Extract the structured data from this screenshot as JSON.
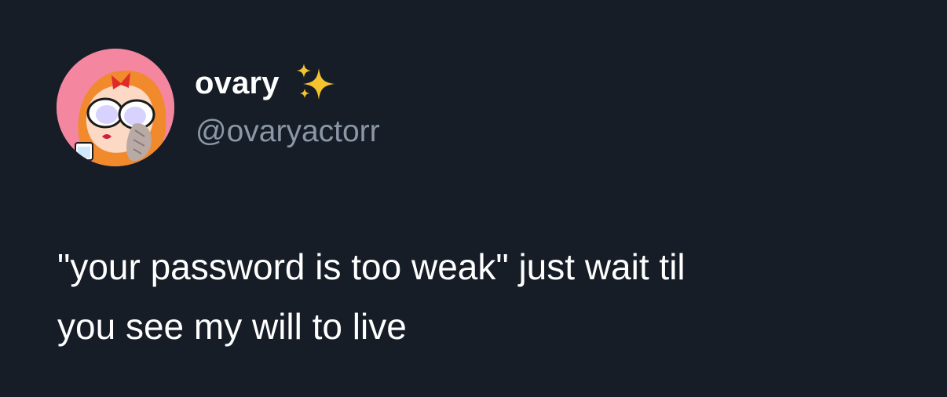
{
  "tweet": {
    "author": {
      "display_name": "ovary",
      "handle": "@ovaryactorr",
      "name_badge_icon": "sparkles-icon",
      "avatar_icon": "cartoon-avatar"
    },
    "text_lines": [
      "\"your password is too weak\" just wait til",
      "you see my will to live"
    ]
  },
  "colors": {
    "background": "#161d27",
    "text_primary": "#ffffff",
    "text_secondary": "#8a97a6",
    "sparkle": "#f4c430",
    "avatar_bg": "#f4869f"
  }
}
